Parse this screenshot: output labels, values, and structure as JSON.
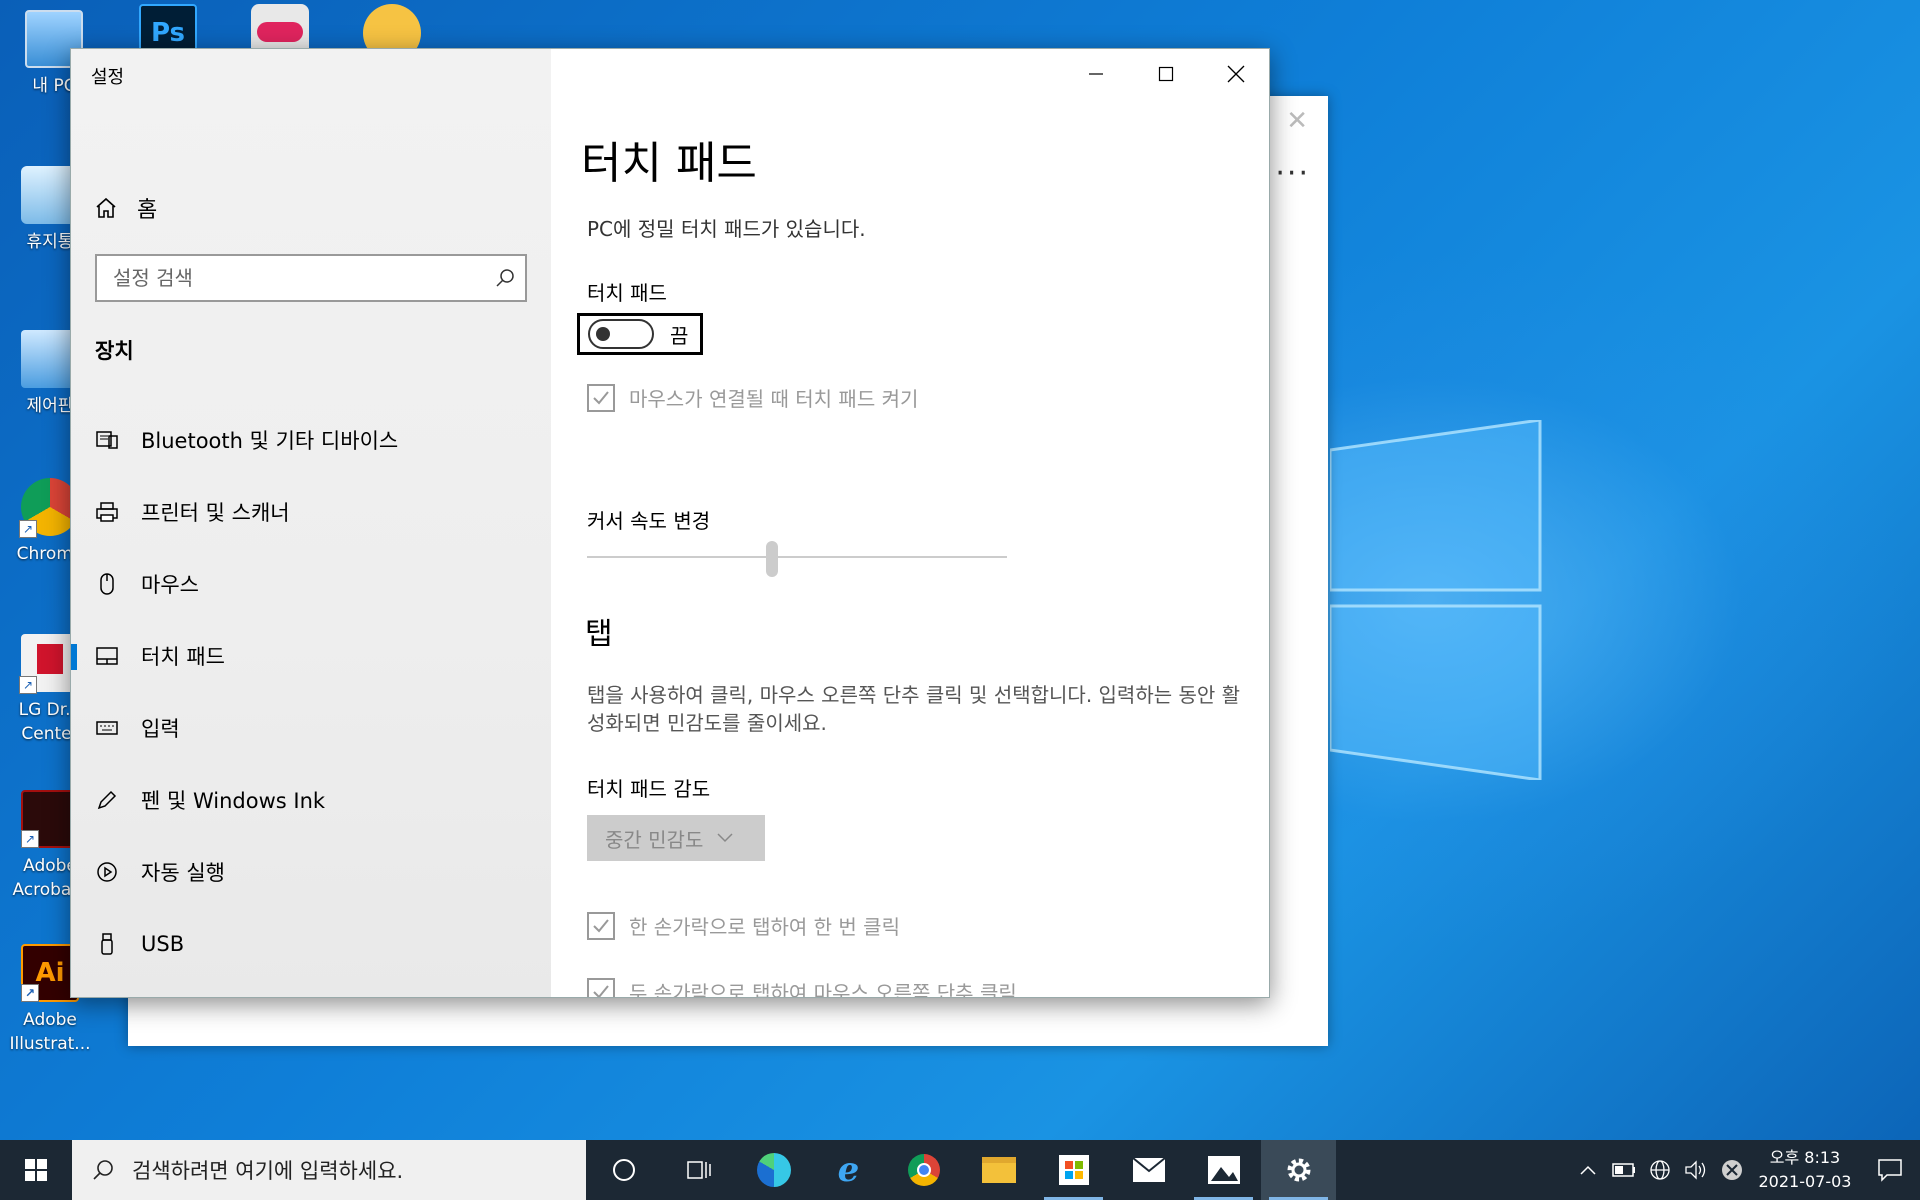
{
  "desktop": {
    "icons": [
      {
        "label": "내 PC"
      },
      {
        "label": "휴지통"
      },
      {
        "label": "제어판"
      },
      {
        "label": "Chrome"
      },
      {
        "label": "LG Dr... Center"
      },
      {
        "label": "Adobe Acroba..."
      },
      {
        "label": "Adobe Illustrat..."
      }
    ]
  },
  "settings": {
    "app_title": "설정",
    "home_label": "홈",
    "search_placeholder": "설정 검색",
    "section": "장치",
    "nav_items": [
      {
        "label": "Bluetooth 및 기타 디바이스",
        "icon": "bluetooth-devices-icon"
      },
      {
        "label": "프린터 및 스캐너",
        "icon": "printer-icon"
      },
      {
        "label": "마우스",
        "icon": "mouse-icon"
      },
      {
        "label": "터치 패드",
        "icon": "touchpad-icon"
      },
      {
        "label": "입력",
        "icon": "keyboard-icon"
      },
      {
        "label": "펜 및 Windows Ink",
        "icon": "pen-icon"
      },
      {
        "label": "자동 실행",
        "icon": "autoplay-icon"
      },
      {
        "label": "USB",
        "icon": "usb-icon"
      }
    ],
    "active_item": "터치 패드",
    "content": {
      "title": "터치 패드",
      "description": "PC에 정밀 터치 패드가 있습니다.",
      "touchpad_label": "터치 패드",
      "toggle_state": "끔",
      "toggle_on": false,
      "mouse_connected_checkbox": "마우스가 연결될 때 터치 패드 켜기",
      "cursor_speed_label": "커서 속도 변경",
      "cursor_speed_level": 0.44,
      "tap_section_title": "탭",
      "tap_description": "탭을 사용하여 클릭, 마우스 오른쪽 단추 클릭 및 선택합니다. 입력하는 동안 활성화되면 민감도를 줄이세요.",
      "sensitivity_label": "터치 패드 감도",
      "sensitivity_value": "중간 민감도",
      "tap_single_checkbox": "한 손가락으로 탭하여 한 번 클릭",
      "tap_double_checkbox": "두 손가락으로 탭하여 마우스 오른쪽 단추 클릭"
    }
  },
  "taskbar": {
    "search_placeholder": "검색하려면 여기에 입력하세요.",
    "time": "오후 8:13",
    "date": "2021-07-03"
  },
  "colors": {
    "accent": "#0078d4",
    "taskbar": "#1c2834"
  }
}
